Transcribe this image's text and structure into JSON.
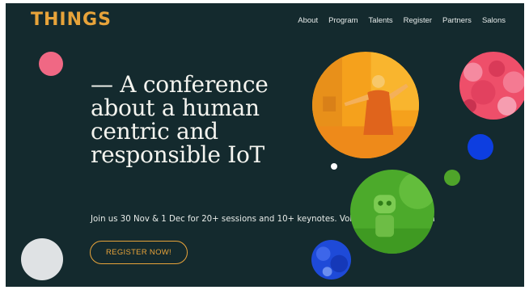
{
  "header": {
    "logo": "THINGS",
    "nav": [
      "About",
      "Program",
      "Talents",
      "Register",
      "Partners",
      "Salons"
    ]
  },
  "hero": {
    "headline_lines": [
      "— A conference",
      "about a human",
      "centric and",
      "responsible IoT"
    ],
    "info": "Join us 30 Nov & 1 Dec for 20+ sessions and 10+ keynotes. Volkshotel, Amsterdam",
    "cta_label": "REGISTER NOW!"
  },
  "colors": {
    "background": "#142a2e",
    "accent": "#e7a33a",
    "pink": "#f06884",
    "blue": "#0d3ee0",
    "green": "#4fa42a",
    "orange": "#f5a11c"
  }
}
